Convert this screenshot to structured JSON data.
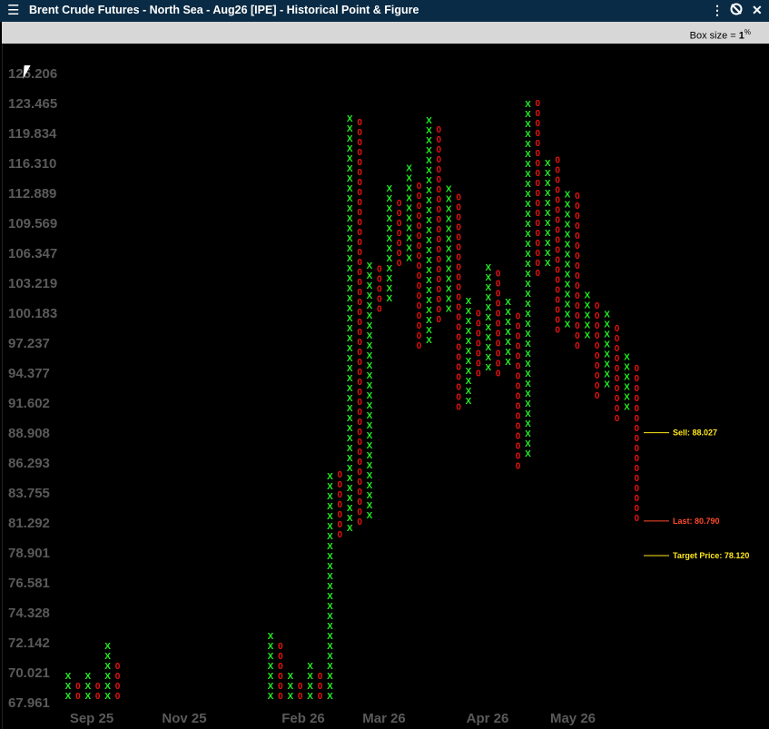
{
  "window": {
    "title": "Brent Crude Futures - North Sea - Aug26 [IPE] - Historical Point & Figure",
    "menu_icon": "hamburger-menu-icon",
    "controls": [
      "more-vertical-icon",
      "contract-switch-icon",
      "close-icon"
    ]
  },
  "toolbar": {
    "box_size_label": "Box size = ",
    "box_size_value": "1",
    "box_size_unit": "%"
  },
  "colors": {
    "x": "#22ee22",
    "o": "#ee1111",
    "sell": "#ffe81a",
    "last": "#ff4a2a",
    "target": "#ffe81a",
    "axis_text": "#5a5a5a"
  },
  "chart_data": {
    "type": "point-and-figure",
    "box_size_percent": 1,
    "y_ticks": [
      "125.206",
      "123.465",
      "119.834",
      "116.310",
      "112.889",
      "109.569",
      "106.347",
      "103.219",
      "100.183",
      "97.237",
      "94.377",
      "91.602",
      "88.908",
      "86.293",
      "83.755",
      "81.292",
      "78.901",
      "76.581",
      "74.328",
      "72.142",
      "70.021",
      "67.961"
    ],
    "x_labels": [
      "Sep 25",
      "Nov 25",
      "Feb 26",
      "Mar 26",
      "Apr 26",
      "May 26"
    ],
    "levels": {
      "sell": {
        "label": "Sell: 88.027",
        "value": 88.027
      },
      "last": {
        "label": "Last: 80.790",
        "value": 80.79
      },
      "target": {
        "label": "Target Price: 78.120",
        "value": 78.12
      }
    },
    "columns": [
      {
        "type": "X",
        "low": 67.961,
        "high": 69.0
      },
      {
        "type": "O",
        "high": 68.7,
        "low": 67.961
      },
      {
        "type": "X",
        "low": 67.961,
        "high": 69.0
      },
      {
        "type": "O",
        "high": 68.7,
        "low": 67.961
      },
      {
        "type": "X",
        "low": 67.961,
        "high": 71.0
      },
      {
        "type": "O",
        "high": 70.0,
        "low": 67.961
      },
      {
        "type": "X",
        "low": 67.961,
        "high": 72.0
      },
      {
        "type": "O",
        "high": 71.0,
        "low": 67.961
      },
      {
        "type": "X",
        "low": 67.961,
        "high": 69.0
      },
      {
        "type": "O",
        "high": 68.7,
        "low": 67.961
      },
      {
        "type": "X",
        "low": 67.961,
        "high": 70.0
      },
      {
        "type": "O",
        "high": 69.5,
        "low": 67.961
      },
      {
        "type": "X",
        "low": 67.961,
        "high": 84.5
      },
      {
        "type": "O",
        "high": 84.0,
        "low": 79.5
      },
      {
        "type": "X",
        "low": 80.0,
        "high": 119.0
      },
      {
        "type": "O",
        "high": 118.3,
        "low": 80.5
      },
      {
        "type": "X",
        "low": 81.0,
        "high": 103.5
      },
      {
        "type": "O",
        "high": 102.5,
        "low": 99.0
      },
      {
        "type": "X",
        "low": 100.0,
        "high": 111.0
      },
      {
        "type": "O",
        "high": 110.0,
        "low": 103.5
      },
      {
        "type": "X",
        "low": 104.0,
        "high": 113.0
      },
      {
        "type": "O",
        "high": 111.0,
        "low": 95.5
      },
      {
        "type": "X",
        "low": 96.0,
        "high": 119.0
      },
      {
        "type": "O",
        "high": 118.3,
        "low": 98.0
      },
      {
        "type": "X",
        "low": 99.0,
        "high": 111.0
      },
      {
        "type": "O",
        "high": 110.0,
        "low": 90.0
      },
      {
        "type": "X",
        "low": 90.5,
        "high": 99.5
      },
      {
        "type": "O",
        "high": 98.3,
        "low": 93.0
      },
      {
        "type": "X",
        "low": 93.5,
        "high": 103.5
      },
      {
        "type": "O",
        "high": 102.5,
        "low": 93.0
      },
      {
        "type": "X",
        "low": 94.0,
        "high": 99.5
      },
      {
        "type": "O",
        "high": 98.3,
        "low": 85.0
      },
      {
        "type": "X",
        "low": 86.0,
        "high": 122.0
      },
      {
        "type": "O",
        "high": 121.0,
        "low": 102.5
      },
      {
        "type": "X",
        "low": 103.5,
        "high": 114.5
      },
      {
        "type": "O",
        "high": 114.0,
        "low": 97.0
      },
      {
        "type": "X",
        "low": 97.5,
        "high": 111.0
      },
      {
        "type": "O",
        "high": 110.0,
        "low": 95.5
      },
      {
        "type": "X",
        "low": 96.5,
        "high": 100.5
      },
      {
        "type": "O",
        "high": 99.5,
        "low": 91.0
      },
      {
        "type": "X",
        "low": 92.0,
        "high": 98.3
      },
      {
        "type": "O",
        "high": 97.0,
        "low": 89.0
      },
      {
        "type": "X",
        "low": 90.0,
        "high": 94.5
      },
      {
        "type": "O",
        "high": 93.5,
        "low": 80.79
      }
    ]
  }
}
